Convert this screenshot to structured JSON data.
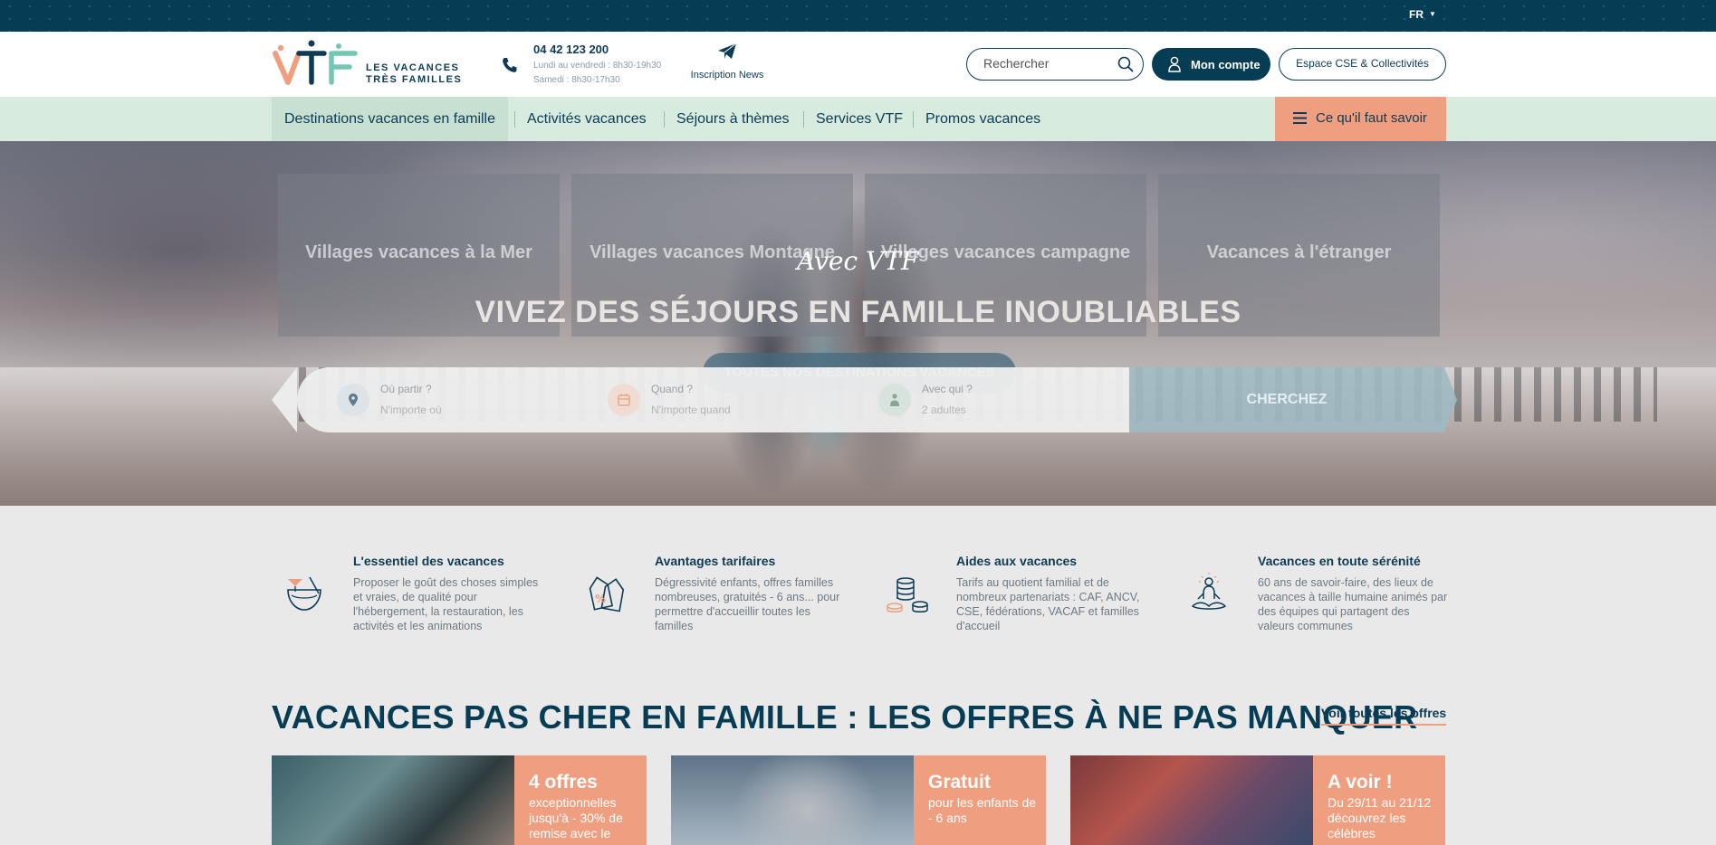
{
  "topbar": {
    "lang": "FR"
  },
  "header": {
    "logo_alt": "VTF",
    "logo_line1": "LES VACANCES",
    "logo_line2": "TRÈS FAMILLES",
    "phone": "04 42 123 200",
    "hours_week": "Lundi au vendredi : 8h30-19h30",
    "hours_sat": "Samedi : 8h30-17h30",
    "news": "Inscription News",
    "search_placeholder": "Rechercher",
    "account": "Mon compte",
    "cse": "Espace CSE & Collectivités"
  },
  "nav": {
    "items": [
      "Destinations vacances en famille",
      "Activités vacances",
      "Séjours à thèmes",
      "Services VTF",
      "Promos vacances"
    ],
    "know": "Ce qu'il faut savoir"
  },
  "hero": {
    "categories": [
      "Villages vacances à la Mer",
      "Villages vacances Montagne",
      "Villages vacances campagne",
      "Vacances à l'étranger"
    ],
    "script": "Avec VTF",
    "title": "VIVEZ DES SÉJOURS EN FAMILLE INOUBLIABLES",
    "button": "TOUTES NOS DESTINATIONS VACANCES"
  },
  "searchbar": {
    "where_label": "Où partir ?",
    "where_value": "N'importe où",
    "when_label": "Quand ?",
    "when_value": "N'importe quand",
    "who_label": "Avec qui ?",
    "who_value": "2 adultes",
    "submit": "CHERCHEZ"
  },
  "features": [
    {
      "title": "L'essentiel des vacances",
      "text": "Proposer le goût des choses simples et vraies, de qualité pour l'hébergement, la restauration, les activités et les animations",
      "icon": "cocktail-icon"
    },
    {
      "title": "Avantages tarifaires",
      "text": "Dégressivité enfants, offres familles nombreuses, gratuités - 6 ans... pour permettre d'accueillir toutes les familles",
      "icon": "price-tag-icon"
    },
    {
      "title": "Aides aux vacances",
      "text": "Tarifs au quotient familial et de nombreux partenariats : CAF, ANCV, CSE, fédérations, VACAF et familles d'accueil",
      "icon": "coins-icon"
    },
    {
      "title": "Vacances en toute sérénité",
      "text": "60 ans de savoir-faire, des lieux de vacances à taille humaine animés par des équipes qui partagent des valeurs communes",
      "icon": "meditation-icon"
    }
  ],
  "offers": {
    "title": "VACANCES PAS CHER EN FAMILLE : LES OFFRES À NE PAS MANQUER",
    "link": "Voir toutes les offres",
    "cards": [
      {
        "title": "4 offres",
        "text": "exceptionnelles jusqu'à - 30% de remise avec le"
      },
      {
        "title": "Gratuit",
        "text": "pour les enfants de - 6 ans"
      },
      {
        "title": "A voir !",
        "text": "Du 29/11 au 21/12 découvrez les célèbres"
      }
    ]
  },
  "colors": {
    "navy": "#063d55",
    "coral": "#ef9f7f",
    "mint": "#d7ebdf",
    "teal_accent": "#74c6b4"
  }
}
